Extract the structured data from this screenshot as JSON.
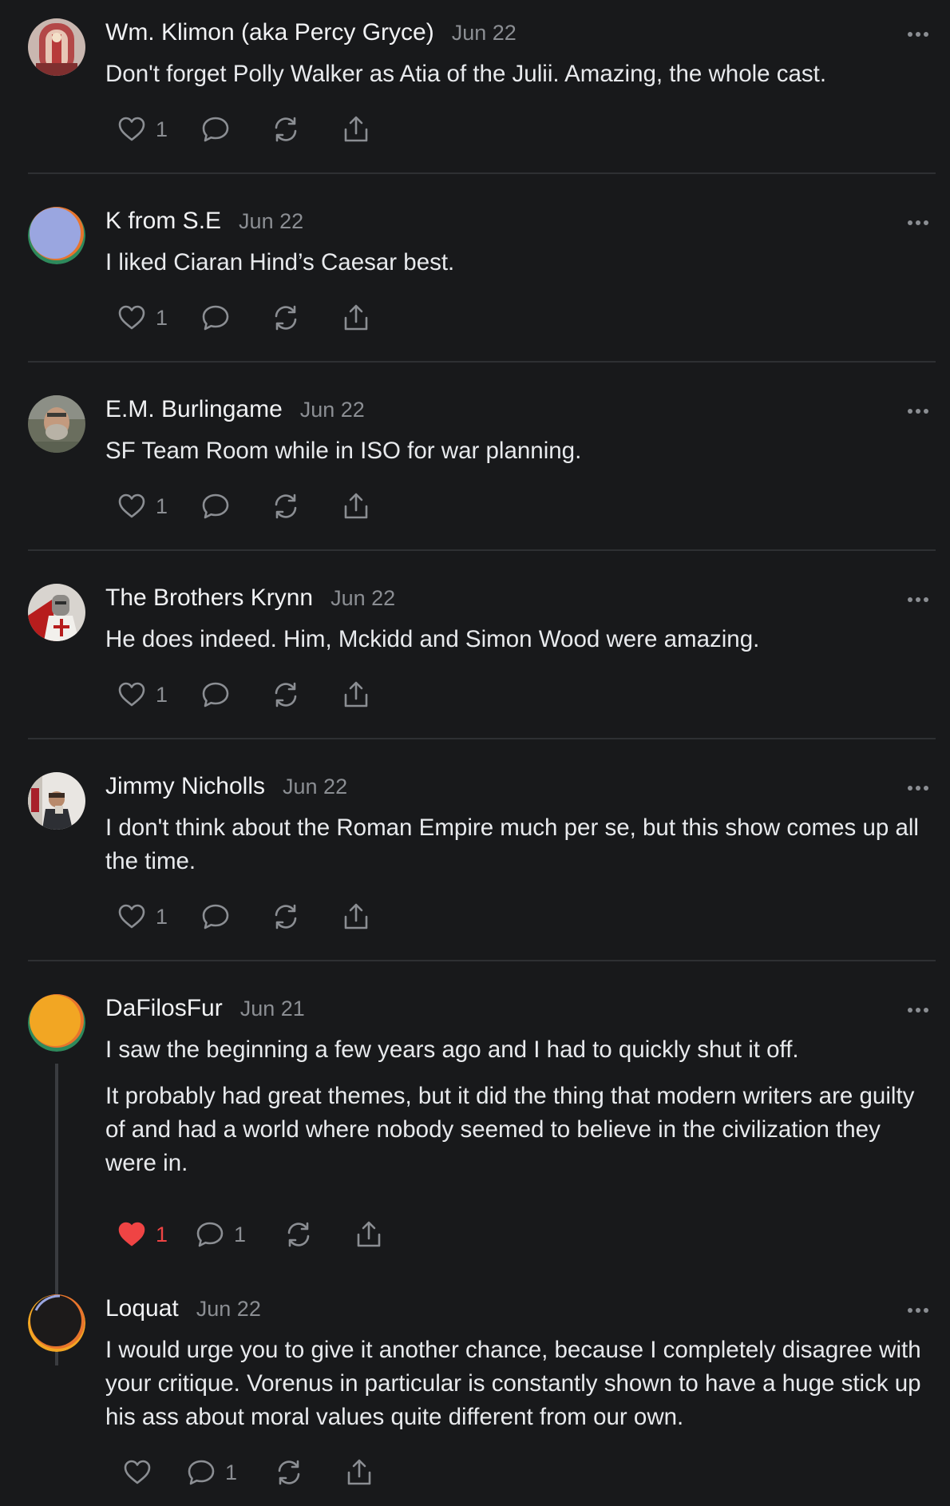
{
  "colors": {
    "background": "#18191b",
    "text": "#eceef0",
    "muted": "#8b8e93",
    "divider": "#2e3033",
    "liked": "#ef4444"
  },
  "comments": [
    {
      "author": "Wm. Klimon (aka Percy Gryce)",
      "date": "Jun 22",
      "avatar": "stained-glass-avatar",
      "paragraphs": [
        "Don't forget Polly Walker as Atia of the Julii. Amazing, the whole cast."
      ],
      "likes": "1",
      "liked": false,
      "replies": ""
    },
    {
      "author": "K from S.E",
      "date": "Jun 22",
      "avatar": "default-lavender-avatar",
      "paragraphs": [
        "I liked Ciaran Hind’s Caesar best."
      ],
      "likes": "1",
      "liked": false,
      "replies": ""
    },
    {
      "author": "E.M. Burlingame",
      "date": "Jun 22",
      "avatar": "bearded-man-avatar",
      "paragraphs": [
        "SF Team Room while in ISO for war planning."
      ],
      "likes": "1",
      "liked": false,
      "replies": ""
    },
    {
      "author": "The Brothers Krynn",
      "date": "Jun 22",
      "avatar": "knight-avatar",
      "paragraphs": [
        "He does indeed. Him, Mckidd and Simon Wood were amazing."
      ],
      "likes": "1",
      "liked": false,
      "replies": ""
    },
    {
      "author": "Jimmy Nicholls",
      "date": "Jun 22",
      "avatar": "man-with-mug-avatar",
      "paragraphs": [
        "I don't think about the Roman Empire much per se, but this show comes up all the time."
      ],
      "likes": "1",
      "liked": false,
      "replies": ""
    },
    {
      "author": "DaFilosFur",
      "date": "Jun 21",
      "avatar": "default-orange-avatar",
      "paragraphs": [
        "I saw the beginning a few years ago and I had to quickly shut it off.",
        "It probably had great themes, but it did the thing that modern writers are guilty of and had a world where nobody seemed to believe in the civilization they were in."
      ],
      "likes": "1",
      "liked": true,
      "replies": "1"
    },
    {
      "author": "Loquat",
      "date": "Jun 22",
      "avatar": "default-black-avatar",
      "paragraphs": [
        "I would urge you to give it another chance, because I completely disagree with your critique. Vorenus in particular is constantly shown to have a huge stick up his ass about moral values quite different from our own."
      ],
      "likes": "",
      "liked": false,
      "replies": "1"
    }
  ]
}
